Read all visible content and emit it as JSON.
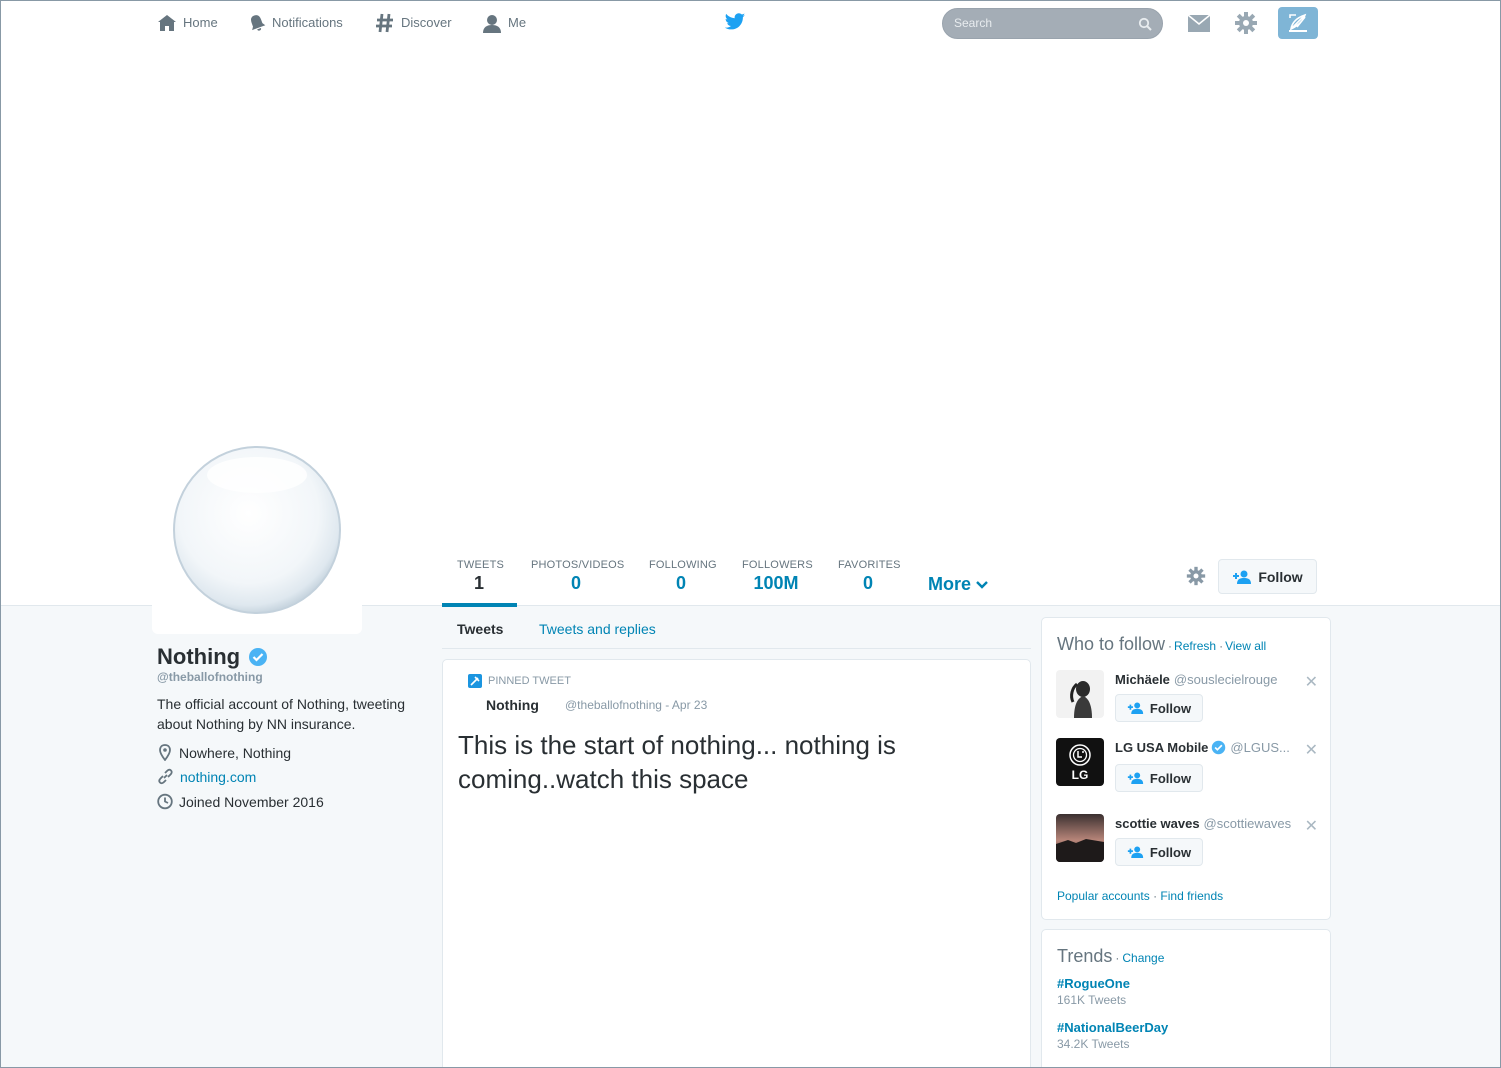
{
  "nav": {
    "home": "Home",
    "notifications": "Notifications",
    "discover": "Discover",
    "me": "Me",
    "search_placeholder": "Search"
  },
  "profile": {
    "stats": [
      {
        "label": "TWEETS",
        "value": "1"
      },
      {
        "label": "PHOTOS/VIDEOS",
        "value": "0"
      },
      {
        "label": "FOLLOWING",
        "value": "0"
      },
      {
        "label": "FOLLOWERS",
        "value": "100M"
      },
      {
        "label": "FAVORITES",
        "value": "0"
      }
    ],
    "more_label": "More",
    "follow_label": "Follow",
    "name": "Nothing",
    "handle": "@theballofnothing",
    "bio": "The official account of Nothing, tweeting about Nothing by NN insurance.",
    "location": "Nowhere, Nothing",
    "website": "nothing.com",
    "joined": "Joined November 2016"
  },
  "timeline": {
    "tabs": [
      "Tweets",
      "Tweets and replies"
    ],
    "pinned_label": "PINNED TWEET",
    "tweet_name": "Nothing",
    "tweet_meta": "@theballofnothing - Apr 23",
    "tweet_text": "This is the start of nothing... nothing is coming..watch this space"
  },
  "who_to_follow": {
    "title": "Who to follow",
    "refresh": "Refresh",
    "view_all": "View all",
    "separator": "·",
    "suggestions": [
      {
        "name": "Michäele",
        "handle": "@souslecielrouge",
        "follow": "Follow"
      },
      {
        "name": "LG USA Mobile",
        "handle": "@LGUS...",
        "follow": "Follow"
      },
      {
        "name": "scottie waves",
        "handle": "@scottiewaves",
        "follow": "Follow"
      }
    ],
    "footer_popular": "Popular accounts",
    "footer_find": "Find friends"
  },
  "trends": {
    "title": "Trends",
    "change": "Change",
    "items": [
      {
        "tag": "#RogueOne",
        "count": "161K Tweets"
      },
      {
        "tag": "#NationalBeerDay",
        "count": "34.2K Tweets"
      }
    ]
  },
  "colors": {
    "link": "#0084b4",
    "twitter_blue": "#1da1f2",
    "verified": "#1b95e0",
    "page_bg": "#f5f8fa"
  }
}
